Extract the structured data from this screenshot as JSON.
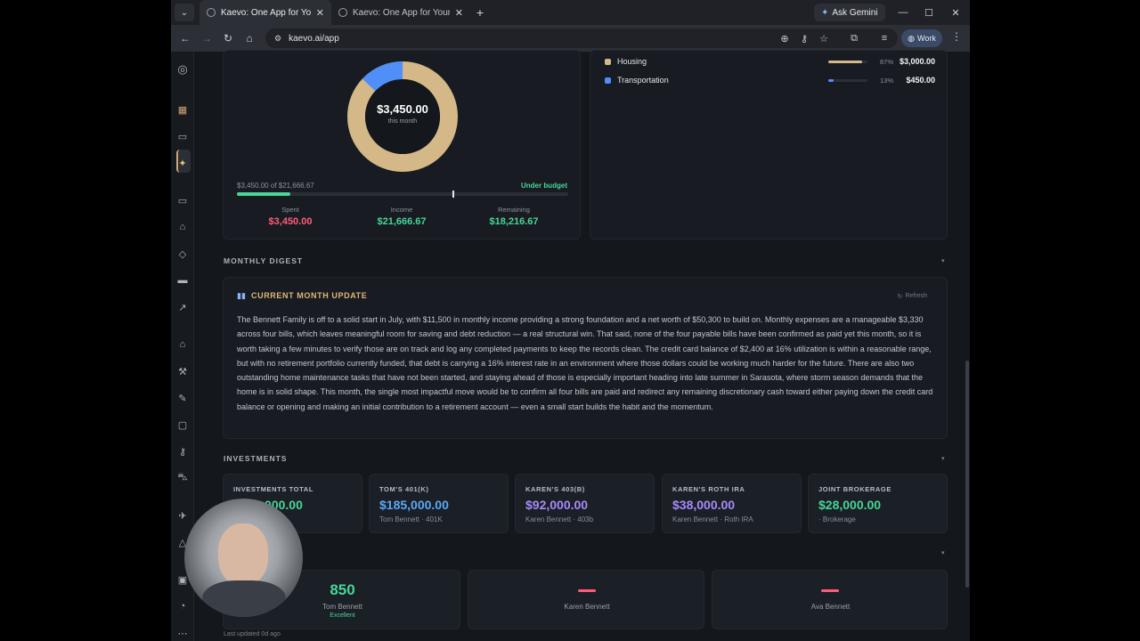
{
  "browser": {
    "tabs": [
      {
        "title": "Kaevo: One App for Your Entire"
      },
      {
        "title": "Kaevo: One App for Your Entire"
      }
    ],
    "ask_gemini": "Ask Gemini",
    "url": "kaevo.ai/app",
    "profile": "Work"
  },
  "budget": {
    "donut_amount": "$3,450.00",
    "donut_sub": "this month",
    "donut_fraction_spent": 0.13,
    "progress_text": "$3,450.00 of $21,666.67",
    "status": "Under budget",
    "progress_fraction": 0.16,
    "marker_fraction": 0.65,
    "stats": [
      {
        "label": "Spent",
        "value": "$3,450.00",
        "color": "#ff5c7a"
      },
      {
        "label": "Income",
        "value": "$21,666.67",
        "color": "#48d597"
      },
      {
        "label": "Remaining",
        "value": "$18,216.67",
        "color": "#48d597"
      }
    ],
    "categories": [
      {
        "name": "Housing",
        "pct": "87%",
        "amount": "$3,000.00",
        "color": "#d4b887",
        "fraction": 0.87
      },
      {
        "name": "Transportation",
        "pct": "13%",
        "amount": "$450.00",
        "color": "#4f8ff7",
        "fraction": 0.13
      }
    ]
  },
  "digest": {
    "section_title": "MONTHLY DIGEST",
    "card_title": "CURRENT MONTH UPDATE",
    "refresh": "Refresh",
    "body": "The Bennett Family is off to a solid start in July, with $11,500 in monthly income providing a strong foundation and a net worth of $50,300 to build on. Monthly expenses are a manageable $3,330 across four bills, which leaves meaningful room for saving and debt reduction — a real structural win. That said, none of the four payable bills have been confirmed as paid yet this month, so it is worth taking a few minutes to verify those are on track and log any completed payments to keep the records clean. The credit card balance of $2,400 at 16% utilization is within a reasonable range, but with no retirement portfolio currently funded, that debt is carrying a 16% interest rate in an environment where those dollars could be working much harder for the future. There are also two outstanding home maintenance tasks that have not been started, and staying ahead of those is especially important heading into late summer in Sarasota, where storm season demands that the home is in solid shape. This month, the single most impactful move would be to confirm all four bills are paid and redirect any remaining discretionary cash toward either paying down the credit card balance or opening and making an initial contribution to a retirement account — even a small start builds the habit and the momentum."
  },
  "investments": {
    "section_title": "INVESTMENTS",
    "cards": [
      {
        "label": "INVESTMENTS TOTAL",
        "value": "$343,000.00",
        "sub": "",
        "color": "#48d597"
      },
      {
        "label": "TOM'S 401(K)",
        "value": "$185,000.00",
        "sub": "Tom Bennett · 401K",
        "color": "#5aa9f7"
      },
      {
        "label": "KAREN'S 403(B)",
        "value": "$92,000.00",
        "sub": "Karen Bennett · 403b",
        "color": "#a78bfa"
      },
      {
        "label": "KAREN'S ROTH IRA",
        "value": "$38,000.00",
        "sub": "Karen Bennett · Roth IRA",
        "color": "#a78bfa"
      },
      {
        "label": "JOINT BROKERAGE",
        "value": "$28,000.00",
        "sub": "· Brokerage",
        "color": "#48d597"
      }
    ]
  },
  "credit": {
    "cards": [
      {
        "score": "850",
        "name": "Tom Bennett",
        "rating": "Excellent"
      },
      {
        "score": "",
        "name": "Karen Bennett",
        "rating": ""
      },
      {
        "score": "",
        "name": "Ava Bennett",
        "rating": ""
      }
    ],
    "last_updated": "Last updated 0d ago"
  }
}
